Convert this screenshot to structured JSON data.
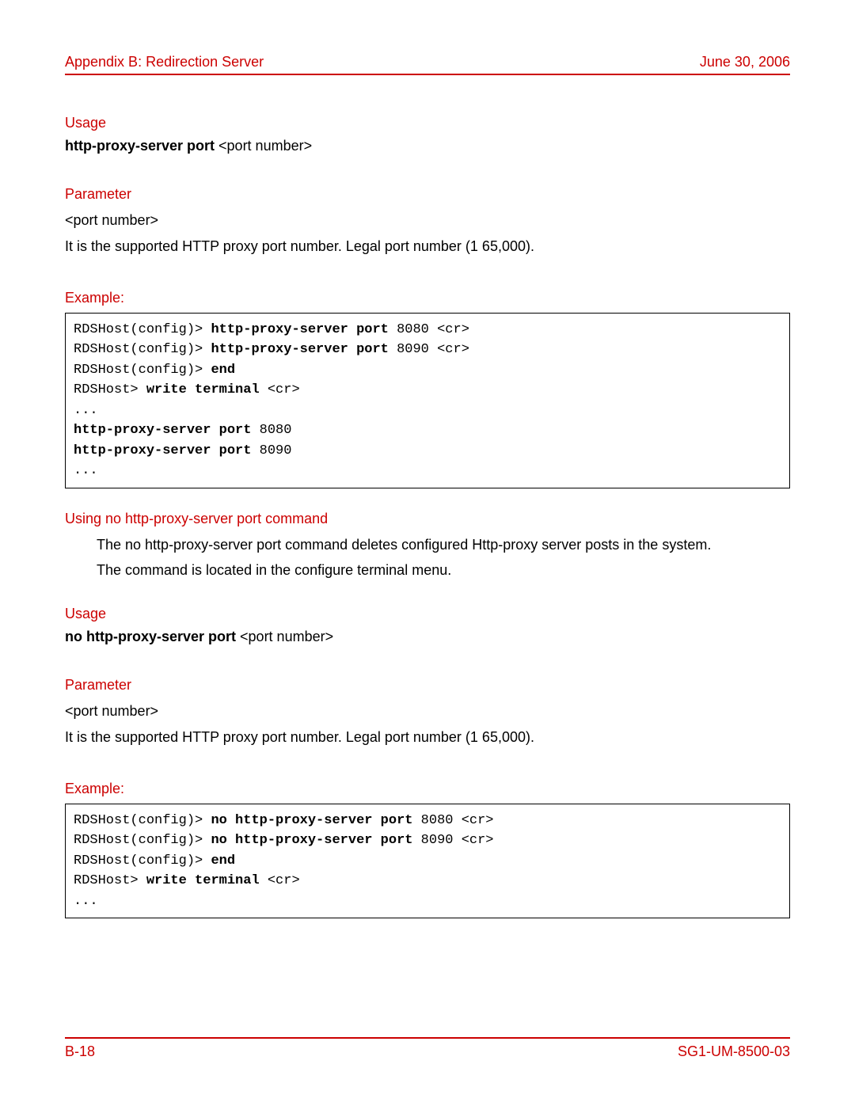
{
  "header": {
    "left": "Appendix B: Redirection Server",
    "right": "June 30, 2006"
  },
  "s1": {
    "usage_h": "Usage",
    "usage_bold": "http-proxy-server port ",
    "usage_rest": "<port number>",
    "param_h": "Parameter",
    "param_name": "<port number>",
    "param_desc": "It is the supported HTTP proxy port number. Legal port number (1   65,000).",
    "example_h": "Example:",
    "code": {
      "l1a": "RDSHost(config)> ",
      "l1b": "http-proxy-server port",
      "l1c": " 8080 <cr>",
      "l2a": "RDSHost(config)> ",
      "l2b": "http-proxy-server port",
      "l2c": " 8090 <cr>",
      "l3a": "RDSHost(config)> ",
      "l3b": "end",
      "l4a": "RDSHost> ",
      "l4b": "write terminal",
      "l4c": " <cr>",
      "l5": "...",
      "l6b": "http-proxy-server port",
      "l6c": " 8080",
      "l7b": "http-proxy-server port",
      "l7c": " 8090",
      "l8": "..."
    }
  },
  "s2": {
    "heading": "Using no http-proxy-server port command",
    "para1": "The no http-proxy-server port command deletes configured Http-proxy server posts in the system.",
    "para2": "The command is located in the  configure terminal  menu.",
    "usage_h": "Usage",
    "usage_bold": "no http-proxy-server port ",
    "usage_rest": "<port number>",
    "param_h": "Parameter",
    "param_name": "<port number>",
    "param_desc": "It is the supported HTTP proxy port number. Legal port number (1   65,000).",
    "example_h": "Example:",
    "code": {
      "l1a": "RDSHost(config)> ",
      "l1b": "no http-proxy-server port",
      "l1c": " 8080 <cr>",
      "l2a": "RDSHost(config)> ",
      "l2b": "no http-proxy-server port",
      "l2c": " 8090 <cr>",
      "l3a": "RDSHost(config)> ",
      "l3b": "end",
      "l4a": "RDSHost> ",
      "l4b": "write terminal",
      "l4c": " <cr>",
      "l5": "..."
    }
  },
  "footer": {
    "left": "B-18",
    "right": "SG1-UM-8500-03"
  }
}
